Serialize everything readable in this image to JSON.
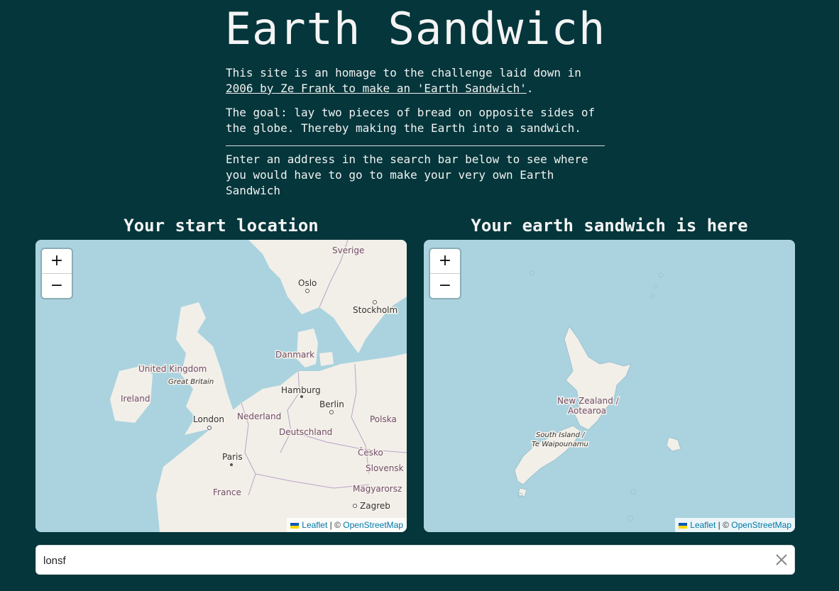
{
  "title": "Earth Sandwich",
  "intro": {
    "p1_before": "This site is an homage to the challenge laid down in ",
    "p1_link": "2006 by Ze Frank to make an 'Earth Sandwich'",
    "p1_after": ".",
    "p2": "The goal: lay two pieces of bread on opposite sides of the globe. Thereby making the Earth into a sandwich.",
    "p3": "Enter an address in the search bar below to see where you would have to go to make your very own Earth Sandwich"
  },
  "maps": {
    "start": {
      "heading": "Your start location",
      "labels": {
        "sverige": "Sverige",
        "oslo": "Oslo",
        "stockholm": "Stockholm",
        "danmark": "Danmark",
        "united_kingdom": "United Kingdom",
        "great_britain": "Great Britain",
        "ireland": "Ireland",
        "hamburg": "Hamburg",
        "berlin": "Berlin",
        "london": "London",
        "nederland": "Nederland",
        "polska": "Polska",
        "deutschland": "Deutschland",
        "paris": "Paris",
        "cesko": "Česko",
        "slovensko": "Slovensk",
        "france": "France",
        "magyarorszag": "Magyarorsz",
        "zagreb": "Zagreb"
      }
    },
    "dest": {
      "heading": "Your earth sandwich is here",
      "labels": {
        "nz_line1": "New Zealand /",
        "nz_line2": "Aotearoa",
        "si_line1": "South Island /",
        "si_line2": "Te Waipounamu"
      }
    },
    "zoom_in": "+",
    "zoom_out": "−",
    "attribution": {
      "leaflet": "Leaflet",
      "separator": " | © ",
      "osm": "OpenStreetMap"
    }
  },
  "search": {
    "value": "lonsf"
  },
  "colors": {
    "background": "#04363b",
    "water": "#aad3df",
    "land": "#f2efe9",
    "link": "#0078a8"
  }
}
